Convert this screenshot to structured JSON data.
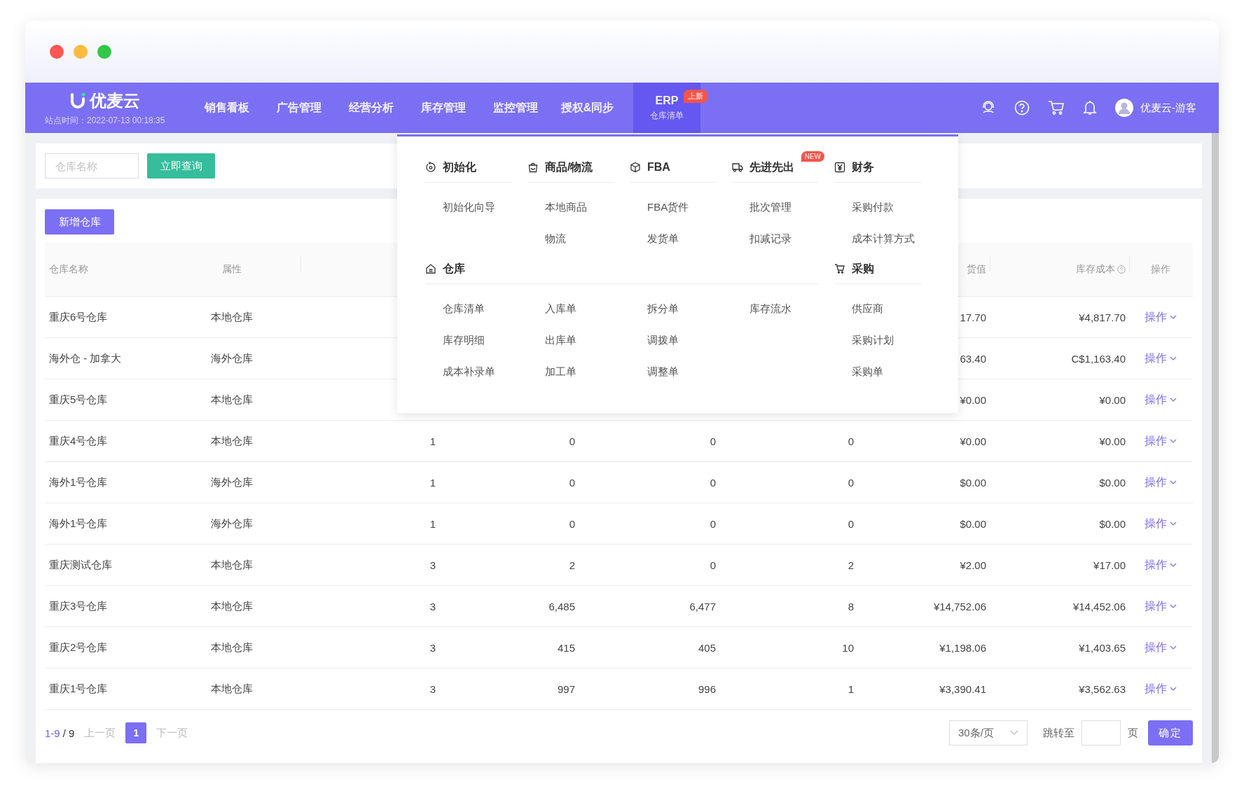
{
  "window": {
    "controls": [
      {
        "color": "#fc5753"
      },
      {
        "color": "#fdbc40"
      },
      {
        "color": "#33c748"
      }
    ]
  },
  "header": {
    "logo": "优麦云",
    "site_time": "站点时间：2022-07-13 00:18:35",
    "nav": [
      {
        "label": "销售看板",
        "selected": false
      },
      {
        "label": "广告管理",
        "selected": false
      },
      {
        "label": "经营分析",
        "selected": false
      },
      {
        "label": "库存管理",
        "selected": false
      },
      {
        "label": "监控管理",
        "selected": false
      },
      {
        "label": "授权&同步",
        "selected": false
      },
      {
        "label": "ERP",
        "sublabel": "仓库清单",
        "badge": "上新",
        "selected": true
      }
    ],
    "user": "优麦云-游客"
  },
  "search": {
    "placeholder": "仓库名称",
    "button": "立即查询"
  },
  "add_button": "新增仓库",
  "table": {
    "columns": [
      {
        "label": "仓库名称"
      },
      {
        "label": "属性"
      },
      {},
      {},
      {},
      {},
      {
        "label": "货值"
      },
      {
        "label": "库存成本",
        "help": true
      },
      {
        "label": "操作"
      }
    ],
    "rows": [
      {
        "cells": [
          "重庆6号仓库",
          "本地仓库",
          null,
          null,
          null,
          null,
          "17.70",
          "¥4,817.70"
        ],
        "action": "操作"
      },
      {
        "cells": [
          "海外仓 - 加拿大",
          "海外仓库",
          null,
          null,
          null,
          null,
          "63.40",
          "C$1,163.40"
        ],
        "action": "操作"
      },
      {
        "cells": [
          "重庆5号仓库",
          "本地仓库",
          null,
          null,
          null,
          null,
          "¥0.00",
          "¥0.00"
        ],
        "action": "操作"
      },
      {
        "cells": [
          "重庆4号仓库",
          "本地仓库",
          "1",
          "0",
          "0",
          "0",
          "¥0.00",
          "¥0.00"
        ],
        "action": "操作"
      },
      {
        "cells": [
          "海外1号仓库",
          "海外仓库",
          "1",
          "0",
          "0",
          "0",
          "$0.00",
          "$0.00"
        ],
        "action": "操作"
      },
      {
        "cells": [
          "海外1号仓库",
          "海外仓库",
          "1",
          "0",
          "0",
          "0",
          "$0.00",
          "$0.00"
        ],
        "action": "操作"
      },
      {
        "cells": [
          "重庆测试仓库",
          "本地仓库",
          "3",
          "2",
          "0",
          "2",
          "¥2.00",
          "¥17.00"
        ],
        "action": "操作"
      },
      {
        "cells": [
          "重庆3号仓库",
          "本地仓库",
          "3",
          "6,485",
          "6,477",
          "8",
          "¥14,752.06",
          "¥14,452.06"
        ],
        "action": "操作"
      },
      {
        "cells": [
          "重庆2号仓库",
          "本地仓库",
          "3",
          "415",
          "405",
          "10",
          "¥1,198.06",
          "¥1,403.65"
        ],
        "action": "操作"
      },
      {
        "cells": [
          "重庆1号仓库",
          "本地仓库",
          "3",
          "997",
          "996",
          "1",
          "¥3,390.41",
          "¥3,562.63"
        ],
        "action": "操作"
      }
    ]
  },
  "menu": {
    "groups": [
      {
        "title": "初始化",
        "kind": "refresh",
        "columns": [
          [
            "初始化向导"
          ]
        ]
      },
      {
        "title": "商品/物流",
        "kind": "bag",
        "columns": [
          [
            "本地商品",
            "物流"
          ]
        ]
      },
      {
        "title": "FBA",
        "kind": "box",
        "columns": [
          [
            "FBA货件",
            "发货单"
          ]
        ]
      },
      {
        "title": "先进先出",
        "kind": "truck",
        "badge": "NEW",
        "columns": [
          [
            "批次管理",
            "扣减记录"
          ]
        ]
      },
      {
        "title": "财务",
        "kind": "yen",
        "columns": [
          [
            "采购付款",
            "成本计算方式"
          ]
        ]
      },
      {
        "title": "仓库",
        "kind": "house",
        "columns": [
          [
            "仓库清单",
            "库存明细",
            "成本补录单"
          ],
          [
            "入库单",
            "出库单",
            "加工单"
          ],
          [
            "拆分单",
            "调拨单",
            "调整单"
          ],
          [
            "库存流水"
          ]
        ]
      },
      {
        "title": "采购",
        "kind": "cart",
        "columns": [
          [
            "供应商",
            "采购计划",
            "采购单"
          ]
        ]
      }
    ]
  },
  "pagination": {
    "range": "1-9",
    "total": "/ 9",
    "prev": {
      "label": "上一页",
      "disabled": true
    },
    "pages": [
      {
        "label": "1",
        "selected": true
      }
    ],
    "next": {
      "label": "下一页",
      "disabled": true
    },
    "page_size": "30条/页",
    "jump_label": "跳转至",
    "page_unit": "页",
    "confirm": "确定"
  }
}
